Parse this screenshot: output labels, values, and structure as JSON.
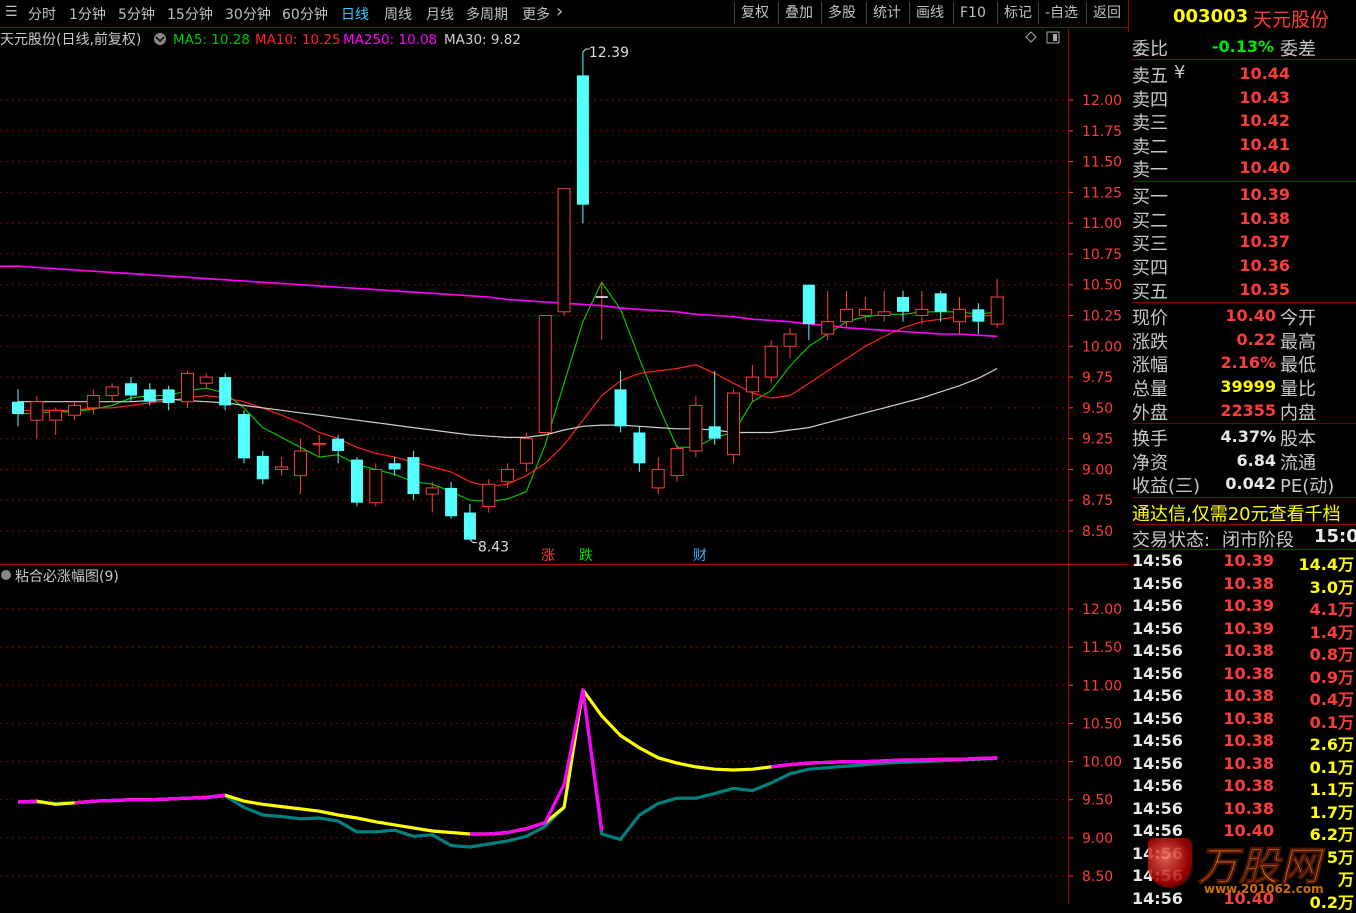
{
  "toolbar": {
    "periods": [
      "分时",
      "1分钟",
      "5分钟",
      "15分钟",
      "30分钟",
      "60分钟",
      "日线",
      "周线",
      "月线",
      "多周期",
      "更多"
    ],
    "active_period": "日线",
    "buttons": [
      "复权",
      "叠加",
      "多股",
      "统计",
      "画线",
      "F10",
      "标记",
      "-自选",
      "返回"
    ]
  },
  "stock": {
    "code": "003003",
    "name": "天元股份"
  },
  "main_chart": {
    "legend_title": "天元股份(日线,前复权)",
    "ma": [
      {
        "label": "MA5: 10.28",
        "color": "#00c800"
      },
      {
        "label": "MA10: 10.25",
        "color": "#ff2020"
      },
      {
        "label": "MA250: 10.08",
        "color": "#ff00ff"
      },
      {
        "label": "MA30: 9.82",
        "color": "#d0d0d0"
      }
    ],
    "high_label": "12.39",
    "low_label": "8.43",
    "event_labels": [
      {
        "text": "涨",
        "color": "#ff3c3c"
      },
      {
        "text": "跌",
        "color": "#00e600"
      },
      {
        "text": "财",
        "color": "#37a8ff"
      }
    ]
  },
  "sub_chart": {
    "title": "粘合必涨幅图(9)"
  },
  "chart_data": [
    {
      "type": "candlestick",
      "y_ticks": [
        12.0,
        11.75,
        11.5,
        11.25,
        11.0,
        10.75,
        10.5,
        10.25,
        10.0,
        9.75,
        9.5,
        9.25,
        9.0,
        8.75,
        8.5
      ],
      "ylim": [
        8.36,
        12.45
      ],
      "candles": [
        [
          9.55,
          9.45,
          9.65,
          9.35
        ],
        [
          9.4,
          9.55,
          9.6,
          9.25
        ],
        [
          9.4,
          9.48,
          9.5,
          9.28
        ],
        [
          9.44,
          9.52,
          9.55,
          9.4
        ],
        [
          9.5,
          9.6,
          9.65,
          9.45
        ],
        [
          9.6,
          9.67,
          9.7,
          9.55
        ],
        [
          9.7,
          9.6,
          9.75,
          9.55
        ],
        [
          9.65,
          9.55,
          9.7,
          9.52
        ],
        [
          9.65,
          9.54,
          9.68,
          9.48
        ],
        [
          9.55,
          9.78,
          9.8,
          9.5
        ],
        [
          9.7,
          9.75,
          9.78,
          9.65
        ],
        [
          9.75,
          9.52,
          9.78,
          9.48
        ],
        [
          9.45,
          9.09,
          9.48,
          9.05
        ],
        [
          9.11,
          8.92,
          9.15,
          8.88
        ],
        [
          9.0,
          9.02,
          9.1,
          8.95
        ],
        [
          8.95,
          9.15,
          9.25,
          8.8
        ],
        [
          9.2,
          9.21,
          9.28,
          9.1
        ],
        [
          9.25,
          9.15,
          9.28,
          9.05
        ],
        [
          9.08,
          8.73,
          9.1,
          8.7
        ],
        [
          8.73,
          9.0,
          9.05,
          8.7
        ],
        [
          9.05,
          9.0,
          9.1,
          8.95
        ],
        [
          9.1,
          8.8,
          9.15,
          8.75
        ],
        [
          8.8,
          8.85,
          8.9,
          8.65
        ],
        [
          8.85,
          8.62,
          8.9,
          8.6
        ],
        [
          8.65,
          8.43,
          8.72,
          8.43
        ],
        [
          8.7,
          8.88,
          8.92,
          8.65
        ],
        [
          8.9,
          9.0,
          9.05,
          8.85
        ],
        [
          9.05,
          9.25,
          9.3,
          8.98
        ],
        [
          9.3,
          10.25,
          10.25,
          9.28
        ],
        [
          10.28,
          11.28,
          11.28,
          10.25
        ],
        [
          12.2,
          11.15,
          12.39,
          11.0
        ],
        [
          10.4,
          10.4,
          10.52,
          10.05
        ],
        [
          9.65,
          9.35,
          9.8,
          9.3
        ],
        [
          9.3,
          9.05,
          9.35,
          8.98
        ],
        [
          8.85,
          9.0,
          9.1,
          8.8
        ],
        [
          8.95,
          9.17,
          9.2,
          8.9
        ],
        [
          9.15,
          9.52,
          9.6,
          9.1
        ],
        [
          9.35,
          9.25,
          9.8,
          9.2
        ],
        [
          9.12,
          9.62,
          9.65,
          9.05
        ],
        [
          9.63,
          9.75,
          9.85,
          9.55
        ],
        [
          9.75,
          10.0,
          10.05,
          9.7
        ],
        [
          10.0,
          10.1,
          10.15,
          9.9
        ],
        [
          10.5,
          10.18,
          10.5,
          10.05
        ],
        [
          10.1,
          10.2,
          10.45,
          10.05
        ],
        [
          10.2,
          10.3,
          10.45,
          10.15
        ],
        [
          10.25,
          10.3,
          10.4,
          10.2
        ],
        [
          10.25,
          10.28,
          10.45,
          10.2
        ],
        [
          10.4,
          10.28,
          10.45,
          10.2
        ],
        [
          10.25,
          10.3,
          10.45,
          10.18
        ],
        [
          10.43,
          10.28,
          10.45,
          10.2
        ],
        [
          10.2,
          10.3,
          10.4,
          10.1
        ],
        [
          10.3,
          10.2,
          10.35,
          10.1
        ],
        [
          10.18,
          10.4,
          10.55,
          10.15
        ]
      ],
      "up_color": "#ff3c3c",
      "down_color": "#54ffff",
      "ma_series": [
        {
          "name": "MA5",
          "color": "#00c800",
          "values": [
            9.45,
            9.46,
            9.47,
            9.47,
            9.49,
            9.52,
            9.58,
            9.6,
            9.6,
            9.64,
            9.66,
            9.62,
            9.5,
            9.34,
            9.26,
            9.18,
            9.1,
            9.12,
            9.04,
            9.0,
            8.96,
            8.9,
            8.88,
            8.82,
            8.75,
            8.74,
            8.76,
            8.82,
            9.2,
            9.7,
            10.2,
            10.52,
            10.3,
            9.9,
            9.52,
            9.18,
            9.18,
            9.26,
            9.3,
            9.55,
            9.64,
            9.84,
            10.0,
            10.1,
            10.2,
            10.24,
            10.26,
            10.26,
            10.28,
            10.28,
            10.28,
            10.26,
            10.28
          ]
        },
        {
          "name": "MA10",
          "color": "#ff2020",
          "values": [
            9.48,
            9.48,
            9.48,
            9.48,
            9.5,
            9.5,
            9.52,
            9.54,
            9.56,
            9.58,
            9.6,
            9.58,
            9.55,
            9.5,
            9.44,
            9.38,
            9.3,
            9.25,
            9.18,
            9.13,
            9.1,
            9.06,
            9.02,
            8.98,
            8.9,
            8.86,
            8.88,
            8.95,
            9.05,
            9.2,
            9.4,
            9.6,
            9.72,
            9.78,
            9.8,
            9.82,
            9.85,
            9.78,
            9.7,
            9.62,
            9.58,
            9.6,
            9.7,
            9.8,
            9.9,
            10.0,
            10.08,
            10.15,
            10.2,
            10.22,
            10.24,
            10.25,
            10.25
          ]
        },
        {
          "name": "MA30",
          "color": "#d0d0d0",
          "values": [
            9.55,
            9.55,
            9.55,
            9.55,
            9.55,
            9.55,
            9.55,
            9.56,
            9.57,
            9.56,
            9.55,
            9.54,
            9.52,
            9.5,
            9.48,
            9.46,
            9.44,
            9.42,
            9.4,
            9.38,
            9.36,
            9.34,
            9.32,
            9.3,
            9.28,
            9.27,
            9.26,
            9.26,
            9.28,
            9.32,
            9.35,
            9.36,
            9.36,
            9.35,
            9.34,
            9.33,
            9.33,
            9.32,
            9.3,
            9.3,
            9.3,
            9.32,
            9.34,
            9.38,
            9.42,
            9.46,
            9.5,
            9.54,
            9.58,
            9.63,
            9.68,
            9.74,
            9.82
          ]
        },
        {
          "name": "MA250",
          "color": "#ff00ff",
          "values": [
            10.65,
            10.64,
            10.63,
            10.62,
            10.61,
            10.6,
            10.59,
            10.58,
            10.57,
            10.56,
            10.55,
            10.54,
            10.53,
            10.52,
            10.51,
            10.5,
            10.49,
            10.48,
            10.47,
            10.46,
            10.45,
            10.44,
            10.43,
            10.42,
            10.41,
            10.4,
            10.38,
            10.37,
            10.36,
            10.35,
            10.34,
            10.33,
            10.31,
            10.3,
            10.29,
            10.28,
            10.26,
            10.25,
            10.24,
            10.22,
            10.21,
            10.2,
            10.18,
            10.17,
            10.15,
            10.14,
            10.13,
            10.12,
            10.11,
            10.1,
            10.1,
            10.09,
            10.08
          ]
        }
      ]
    },
    {
      "type": "line",
      "title": "粘合必涨幅图(9)",
      "y_ticks": [
        12.0,
        11.5,
        11.0,
        10.5,
        10.0,
        9.5,
        9.0,
        8.5
      ],
      "ylim": [
        8.35,
        12.35
      ],
      "series": [
        {
          "color": "#008080",
          "values": [
            9.47,
            9.47,
            9.45,
            9.46,
            9.48,
            9.49,
            9.5,
            9.5,
            9.51,
            9.52,
            9.53,
            9.55,
            9.4,
            9.3,
            9.28,
            9.25,
            9.26,
            9.22,
            9.08,
            9.08,
            9.1,
            9.02,
            9.04,
            8.9,
            8.88,
            8.92,
            8.96,
            9.02,
            9.15,
            9.4,
            10.94,
            9.05,
            8.98,
            9.3,
            9.45,
            9.52,
            9.52,
            9.58,
            9.65,
            9.62,
            9.72,
            9.84,
            9.9,
            9.92,
            9.94,
            9.96,
            9.98,
            9.99,
            10.0,
            10.01,
            10.02,
            10.03,
            10.04
          ]
        },
        {
          "color": "#ffff00",
          "values": [
            9.47,
            9.48,
            9.44,
            9.46,
            9.48,
            9.49,
            9.5,
            9.5,
            9.51,
            9.52,
            9.53,
            9.56,
            9.48,
            9.44,
            9.41,
            9.38,
            9.35,
            9.3,
            9.26,
            9.21,
            9.17,
            9.13,
            9.09,
            9.07,
            9.05,
            9.05,
            9.07,
            9.12,
            9.2,
            9.4,
            10.94,
            10.6,
            10.34,
            10.18,
            10.05,
            9.98,
            9.93,
            9.9,
            9.89,
            9.9,
            9.93,
            9.96,
            9.98,
            9.99,
            10.0,
            10.0,
            10.01,
            10.02,
            10.02,
            10.03,
            10.03,
            10.04,
            10.05
          ]
        },
        {
          "color": "#ff00ff",
          "values": [
            9.47,
            9.48,
            null,
            9.46,
            9.48,
            9.49,
            9.5,
            9.5,
            9.51,
            9.52,
            9.53,
            9.56,
            null,
            null,
            null,
            null,
            null,
            null,
            null,
            null,
            null,
            null,
            null,
            null,
            9.05,
            9.05,
            9.07,
            9.12,
            9.2,
            9.7,
            10.94,
            9.1,
            null,
            null,
            null,
            null,
            null,
            null,
            null,
            null,
            9.93,
            9.96,
            9.98,
            9.99,
            10.0,
            10.0,
            10.01,
            10.02,
            10.02,
            10.03,
            10.03,
            10.04,
            10.05
          ]
        }
      ]
    }
  ],
  "quote_panel": {
    "weibi": {
      "label": "委比",
      "value": "-0.13%",
      "right_label": "委差"
    },
    "asks": [
      {
        "label": "卖五",
        "mark": "¥",
        "price": "10.44"
      },
      {
        "label": "卖四",
        "price": "10.43"
      },
      {
        "label": "卖三",
        "price": "10.42"
      },
      {
        "label": "卖二",
        "price": "10.41"
      },
      {
        "label": "卖一",
        "price": "10.40"
      }
    ],
    "bids": [
      {
        "label": "买一",
        "price": "10.39"
      },
      {
        "label": "买二",
        "price": "10.38"
      },
      {
        "label": "买三",
        "price": "10.37"
      },
      {
        "label": "买四",
        "price": "10.36"
      },
      {
        "label": "买五",
        "price": "10.35"
      }
    ],
    "stats": [
      {
        "label": "现价",
        "value": "10.40",
        "color": "#ff3c3c",
        "right": "今开"
      },
      {
        "label": "涨跌",
        "value": "0.22",
        "color": "#ff3c3c",
        "right": "最高"
      },
      {
        "label": "涨幅",
        "value": "2.16%",
        "color": "#ff3c3c",
        "right": "最低"
      },
      {
        "label": "总量",
        "value": "39999",
        "color": "#ffff00",
        "right": "量比"
      },
      {
        "label": "外盘",
        "value": "22355",
        "color": "#ff3c3c",
        "right": "内盘"
      }
    ],
    "stats2": [
      {
        "label": "换手",
        "value": "4.37%",
        "right": "股本"
      },
      {
        "label": "净资",
        "value": "6.84",
        "right": "流通"
      },
      {
        "label": "收益(三)",
        "value": "0.042",
        "right": "PE(动)"
      }
    ],
    "promo": "通达信,仅需20元查看千档",
    "trade_state": {
      "label": "交易状态:",
      "value": "闭市阶段",
      "time": "15:00"
    },
    "ticks": [
      {
        "time": "14:56",
        "price": "10.39",
        "vol": "14.4万",
        "vcolor": "#ffff00"
      },
      {
        "time": "14:56",
        "price": "10.38",
        "vol": "3.0万",
        "vcolor": "#ffff00"
      },
      {
        "time": "14:56",
        "price": "10.39",
        "vol": "4.1万",
        "vcolor": "#ff3c3c"
      },
      {
        "time": "14:56",
        "price": "10.39",
        "vol": "1.4万",
        "vcolor": "#ff3c3c"
      },
      {
        "time": "14:56",
        "price": "10.38",
        "vol": "0.8万",
        "vcolor": "#ff3c3c"
      },
      {
        "time": "14:56",
        "price": "10.38",
        "vol": "0.9万",
        "vcolor": "#ff3c3c"
      },
      {
        "time": "14:56",
        "price": "10.38",
        "vol": "0.4万",
        "vcolor": "#ff3c3c"
      },
      {
        "time": "14:56",
        "price": "10.38",
        "vol": "0.1万",
        "vcolor": "#ff3c3c"
      },
      {
        "time": "14:56",
        "price": "10.38",
        "vol": "2.6万",
        "vcolor": "#ffff00"
      },
      {
        "time": "14:56",
        "price": "10.38",
        "vol": "0.1万",
        "vcolor": "#ffff00"
      },
      {
        "time": "14:56",
        "price": "10.38",
        "vol": "1.1万",
        "vcolor": "#ffff00"
      },
      {
        "time": "14:56",
        "price": "10.38",
        "vol": "1.7万",
        "vcolor": "#ffff00"
      },
      {
        "time": "14:56",
        "price": "10.40",
        "vol": "6.2万",
        "vcolor": "#ffff00"
      },
      {
        "time": "14:56",
        "price": "",
        "vol": "5万",
        "vcolor": "#ffff00"
      },
      {
        "time": "14:56",
        "price": "",
        "vol": "万",
        "vcolor": "#ffff00"
      },
      {
        "time": "14:56",
        "price": "10.40",
        "vol": "0.2万",
        "vcolor": "#ffff00"
      }
    ]
  },
  "watermark": {
    "text": "万股网",
    "url": "www.201062.com"
  }
}
